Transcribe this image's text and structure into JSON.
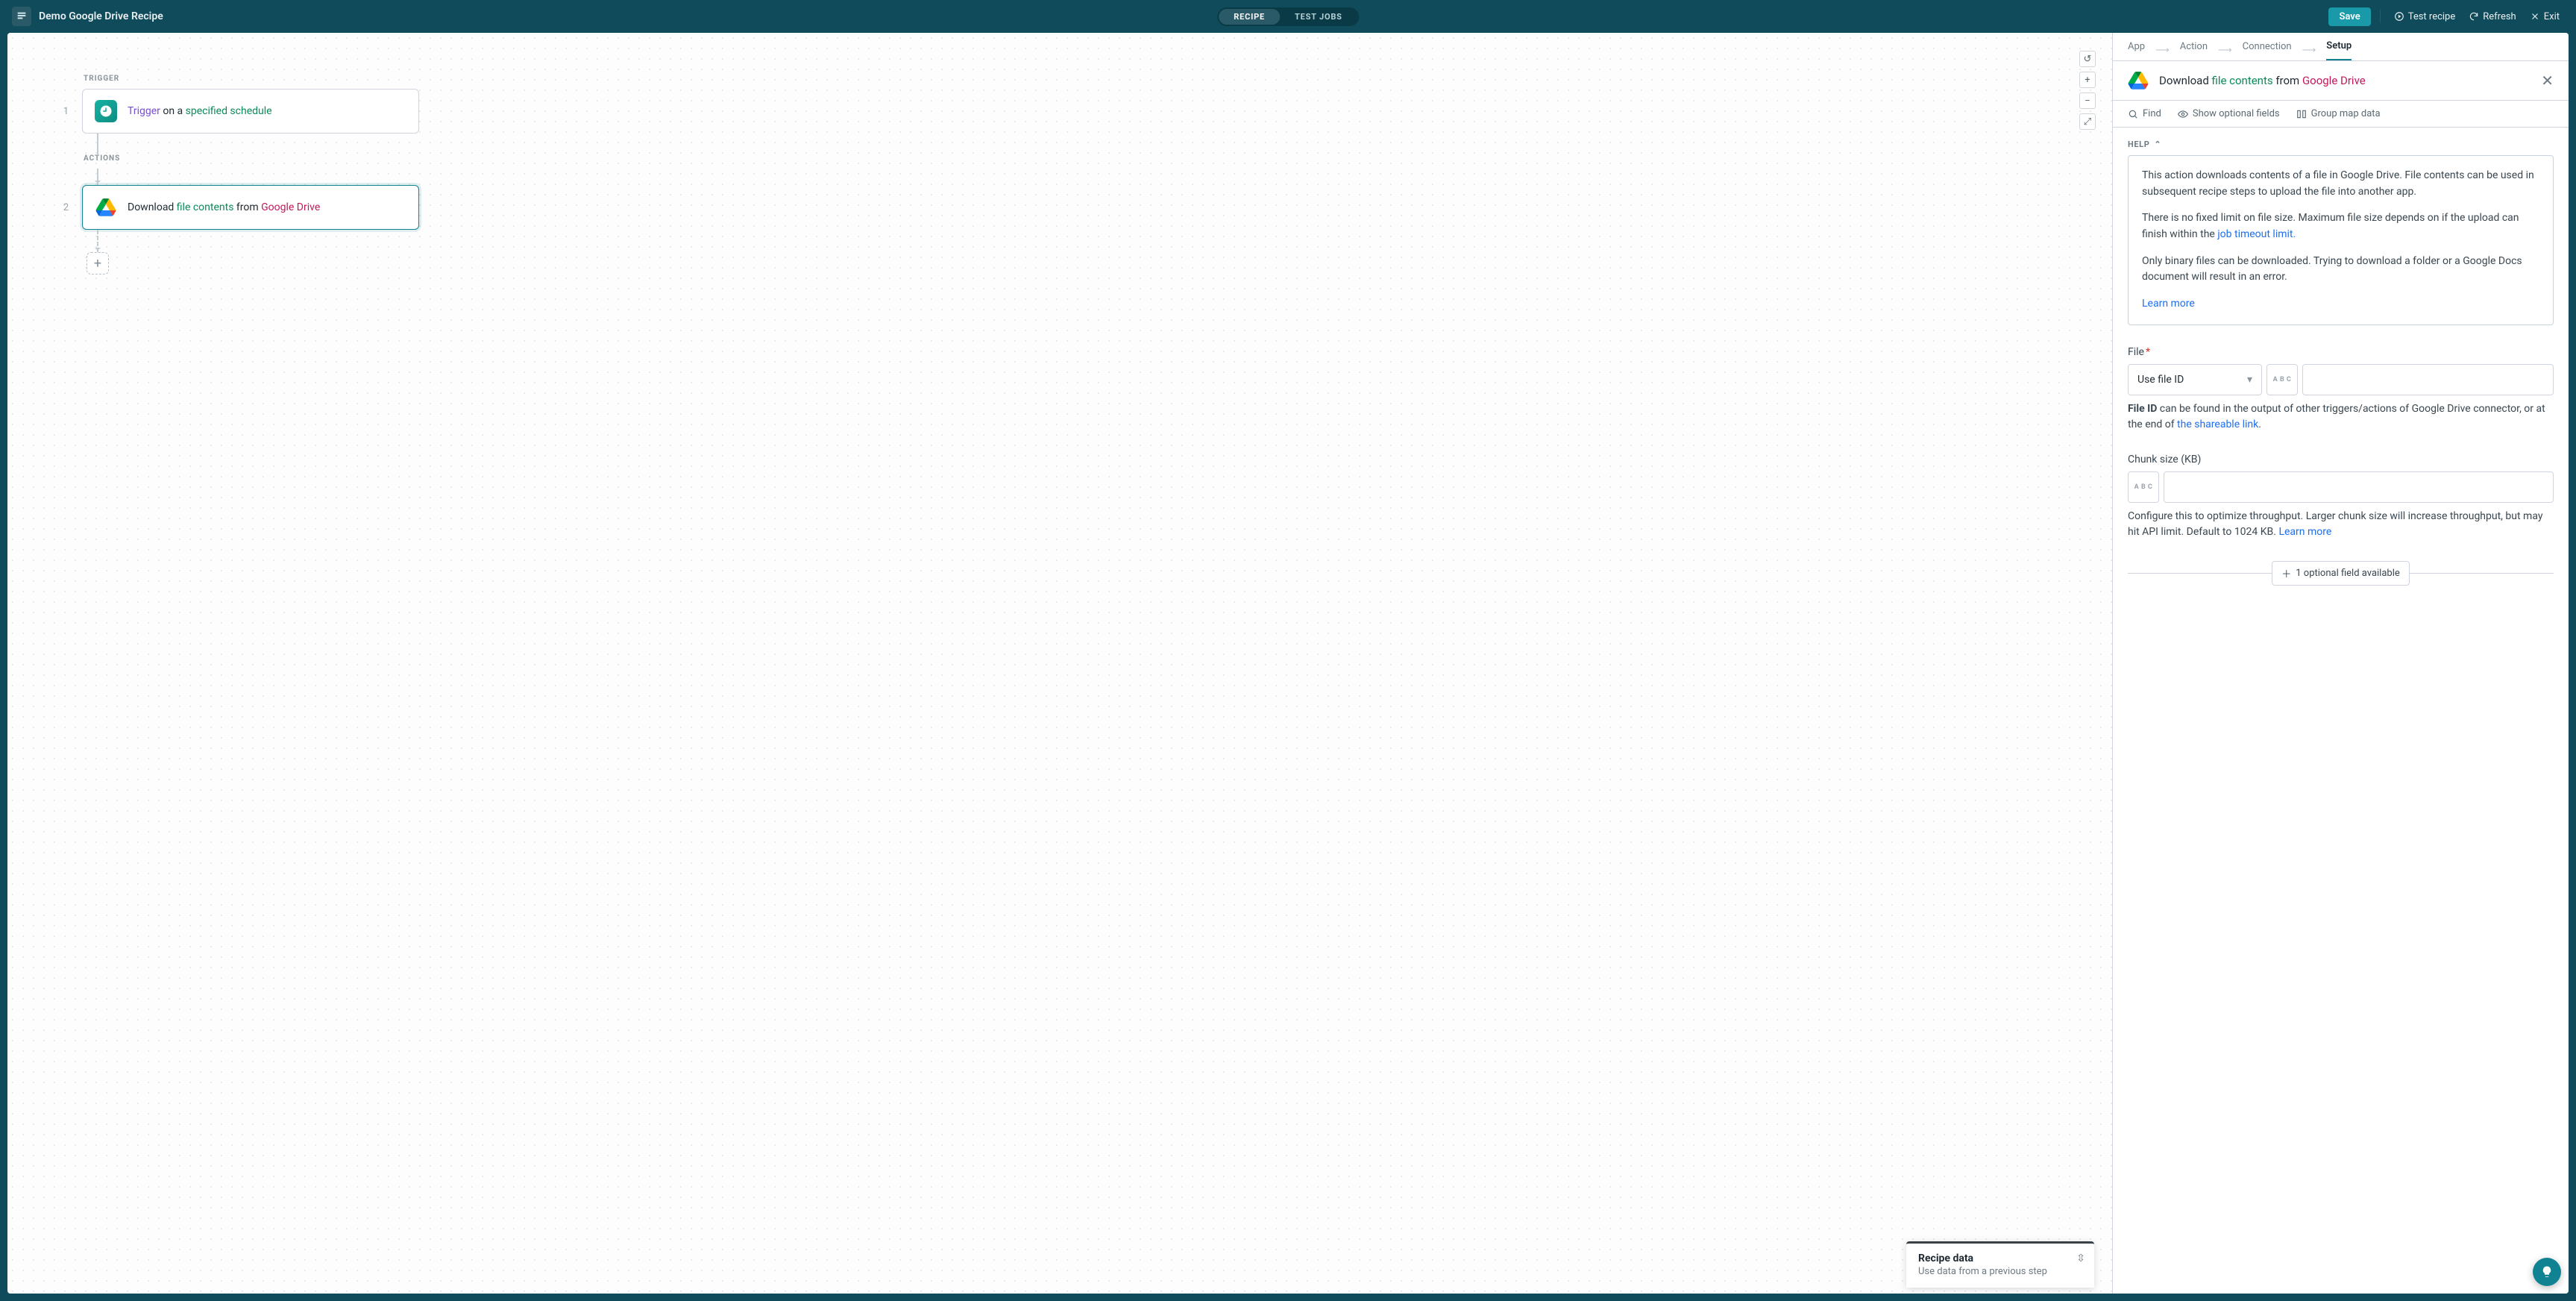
{
  "top": {
    "title": "Demo Google Drive Recipe",
    "toggle_recipe": "RECIPE",
    "toggle_jobs": "TEST JOBS",
    "save": "Save",
    "test_recipe": "Test recipe",
    "refresh": "Refresh",
    "exit": "Exit"
  },
  "canvas": {
    "trigger_label": "TRIGGER",
    "actions_label": "ACTIONS",
    "step1_num": "1",
    "step2_num": "2",
    "step1": {
      "trigger": "Trigger",
      "mid": " on a ",
      "schedule": "specified schedule"
    },
    "step2": {
      "download": "Download ",
      "file_contents": "file contents",
      "from": " from ",
      "gdrive": "Google Drive"
    }
  },
  "recipe_data": {
    "title": "Recipe data",
    "sub": "Use data from a previous step"
  },
  "bc": {
    "app": "App",
    "action": "Action",
    "connection": "Connection",
    "setup": "Setup"
  },
  "panel_head": {
    "download": "Download ",
    "file_contents": "file contents",
    "from": " from ",
    "gdrive": "Google Drive"
  },
  "toolbar2": {
    "find": "Find",
    "show_optional": "Show optional fields",
    "group_map": "Group map data"
  },
  "help": {
    "label": "HELP",
    "p1": "This action downloads contents of a file in Google Drive. File contents can be used in subsequent recipe steps to upload the file into another app.",
    "p2a": "There is no fixed limit on file size. Maximum file size depends on if the upload can finish within the ",
    "p2link": "job timeout limit.",
    "p3": "Only binary files can be downloaded. Trying to download a folder or a Google Docs document will result in an error.",
    "learn_more": "Learn more"
  },
  "file_field": {
    "label": "File",
    "select": "Use file ID",
    "chip": "A B C",
    "hint_b": "File ID",
    "hint_a": " can be found in the output of other triggers/actions of Google Drive connector, or at the end of ",
    "hint_link": "the shareable link",
    "hint_end": "."
  },
  "chunk_field": {
    "label": "Chunk size (KB)",
    "chip": "A B C",
    "hint": "Configure this to optimize throughput. Larger chunk size will increase throughput, but may hit API limit. Default to 1024 KB. ",
    "learn_more": "Learn more"
  },
  "opt_pill": "1 optional field available"
}
